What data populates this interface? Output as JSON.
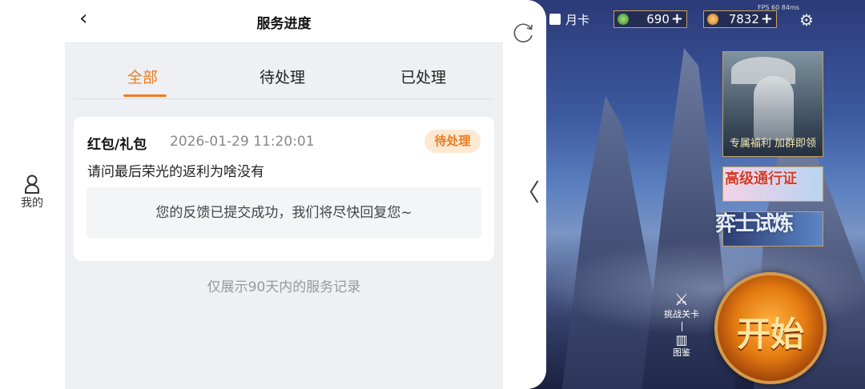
{
  "game": {
    "month_card": "月卡",
    "jade": "690",
    "coins": "7832",
    "fps": "FPS 60  84ms",
    "banner_caption": "专属福利 加群即领",
    "pass_banner": "高级通行证",
    "trial_banner": "弈士试炼",
    "challenge_label": "挑战关卡",
    "atlas_label": "图鉴",
    "start_button": "开始"
  },
  "sidebar": {
    "profile_label": "我的"
  },
  "header": {
    "title": "服务进度"
  },
  "tabs": [
    {
      "label": "全部",
      "active": true
    },
    {
      "label": "待处理",
      "active": false
    },
    {
      "label": "已处理",
      "active": false
    }
  ],
  "records": [
    {
      "category": "红包/礼包",
      "time": "2026-01-29 11:20:01",
      "status": "待处理",
      "question": "请问最后荣光的返利为啥没有",
      "reply": "您的反馈已提交成功，我们将尽快回复您~"
    }
  ],
  "footnote": "仅展示90天内的服务记录",
  "colors": {
    "accent": "#f07b1d",
    "badge_bg": "#fde8d2"
  }
}
